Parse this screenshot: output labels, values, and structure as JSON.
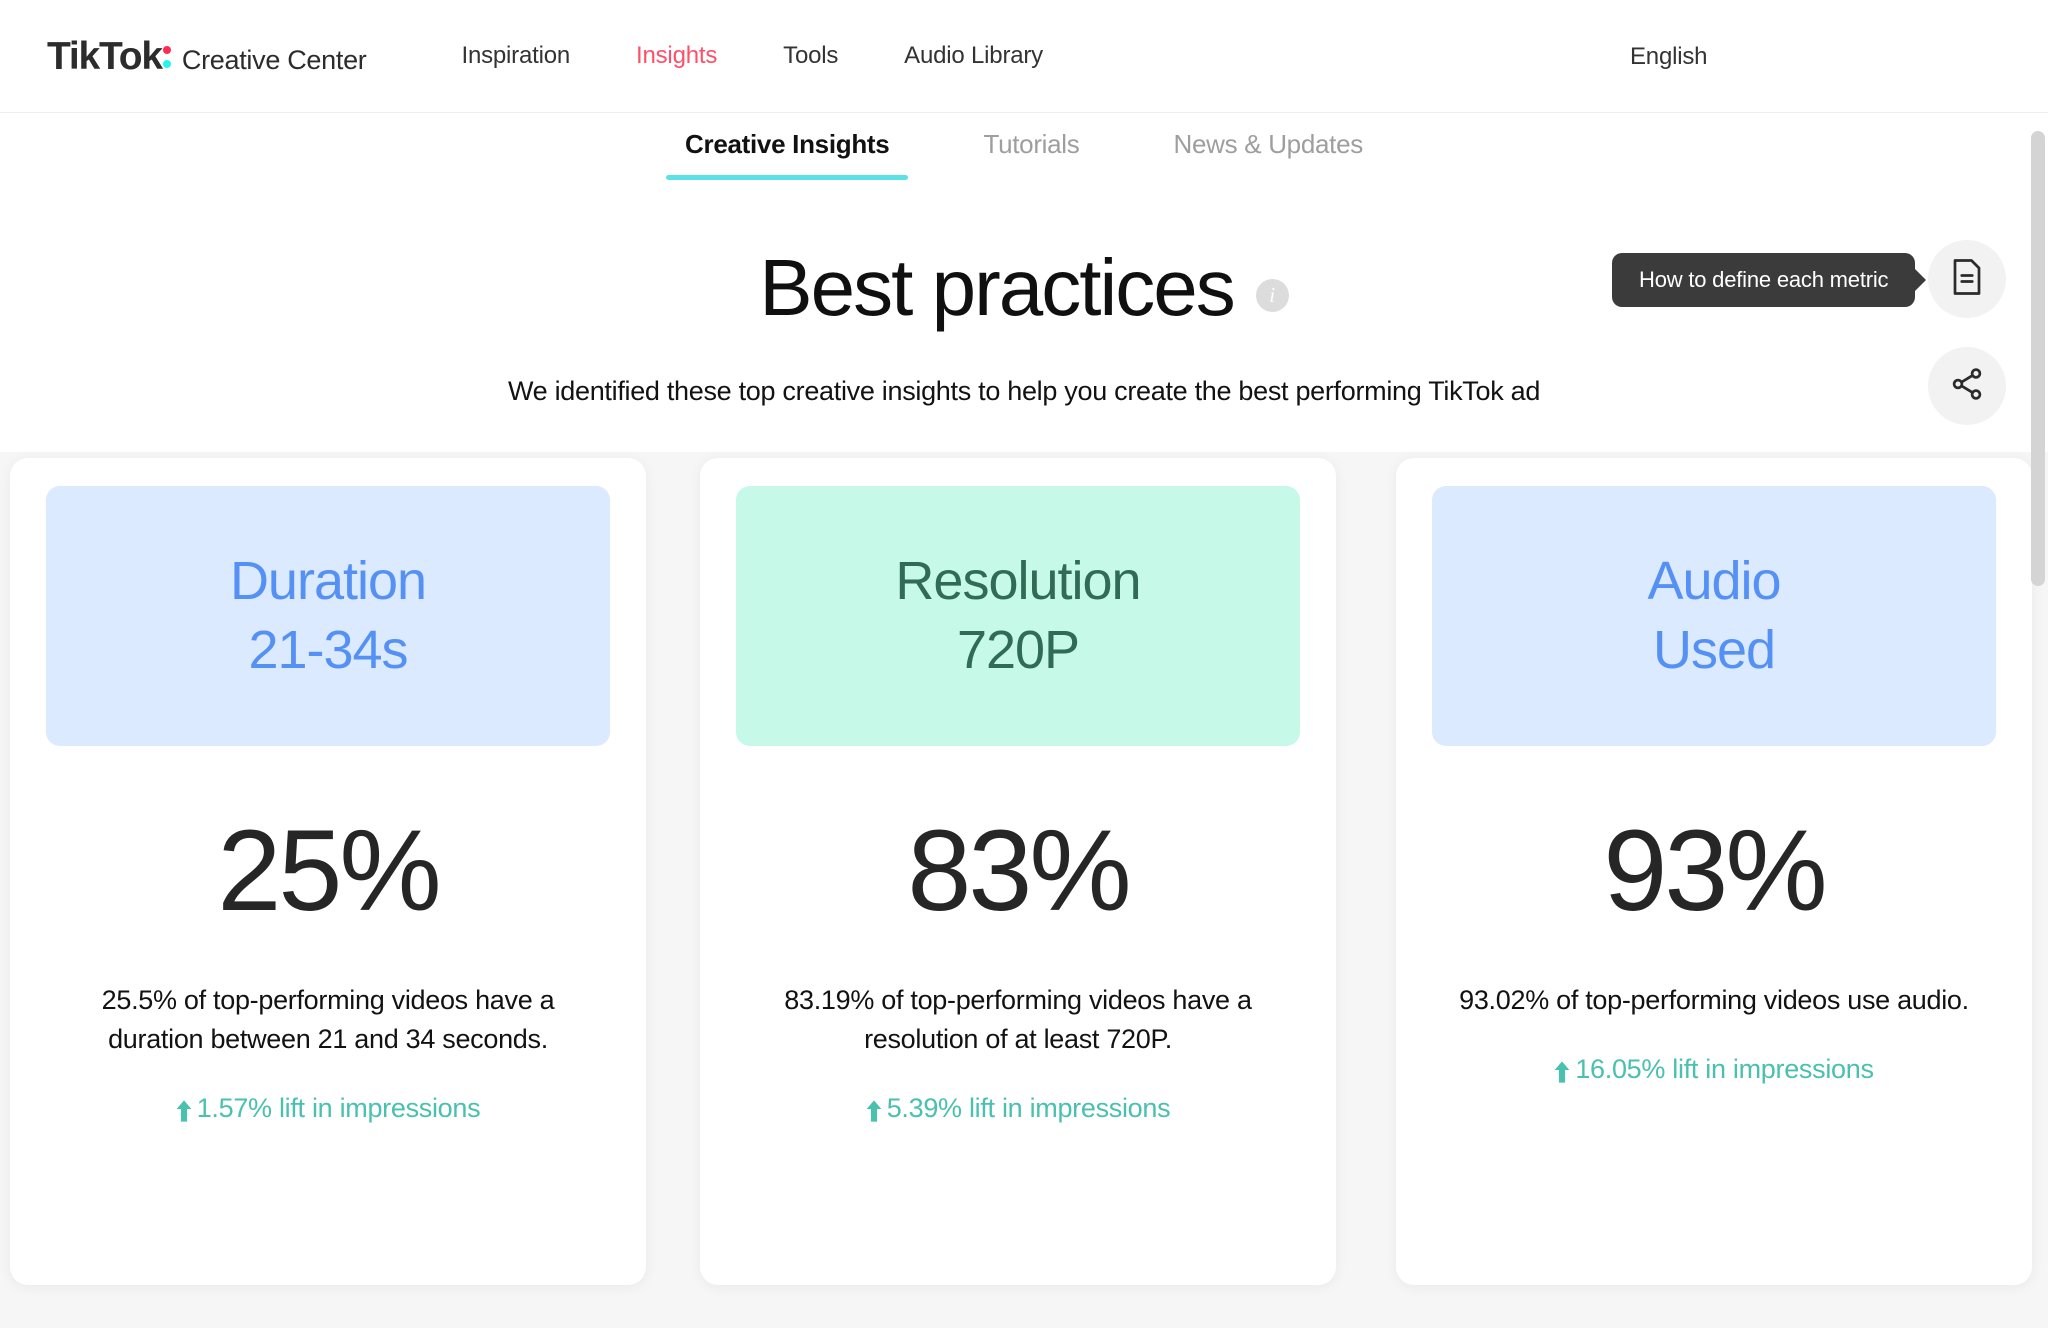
{
  "header": {
    "logo_text": "TikTok",
    "logo_sub": "Creative Center",
    "nav": [
      {
        "label": "Inspiration",
        "active": false
      },
      {
        "label": "Insights",
        "active": true
      },
      {
        "label": "Tools",
        "active": false
      },
      {
        "label": "Audio Library",
        "active": false
      }
    ],
    "language": "English"
  },
  "subnav": {
    "tabs": [
      {
        "label": "Creative Insights",
        "active": true
      },
      {
        "label": "Tutorials",
        "active": false
      },
      {
        "label": "News & Updates",
        "active": false
      }
    ]
  },
  "hero": {
    "title": "Best practices",
    "info_icon": "info-icon",
    "subtitle": "We identified these top creative insights to help you create the best performing TikTok ad"
  },
  "tooltip": {
    "text": "How to define each metric"
  },
  "actions": {
    "doc_icon": "document-icon",
    "share_icon": "share-icon"
  },
  "cards": [
    {
      "banner_line1": "Duration",
      "banner_line2": "21-34s",
      "banner_bg": "#dbeafe",
      "banner_fg": "#5591f5",
      "percent": "25%",
      "description": "25.5% of top-performing videos have a duration between 21 and 34 seconds.",
      "lift": "1.57% lift in impressions",
      "lift_color": "#4ac0ae"
    },
    {
      "banner_line1": "Resolution",
      "banner_line2": "720P",
      "banner_bg": "#c7f9e8",
      "banner_fg": "#2f6b56",
      "percent": "83%",
      "description": "83.19% of top-performing videos have a resolution of at least 720P.",
      "lift": "5.39% lift in impressions",
      "lift_color": "#4ac0ae"
    },
    {
      "banner_line1": "Audio",
      "banner_line2": "Used",
      "banner_bg": "#dbeafe",
      "banner_fg": "#5591f5",
      "percent": "93%",
      "description": "93.02% of top-performing videos use audio.",
      "lift": "16.05% lift in impressions",
      "lift_color": "#4ac0ae"
    }
  ],
  "colors": {
    "accent_red": "#fe5068",
    "accent_cyan": "#5ce2e6",
    "page_bg": "#f6f6f6"
  }
}
